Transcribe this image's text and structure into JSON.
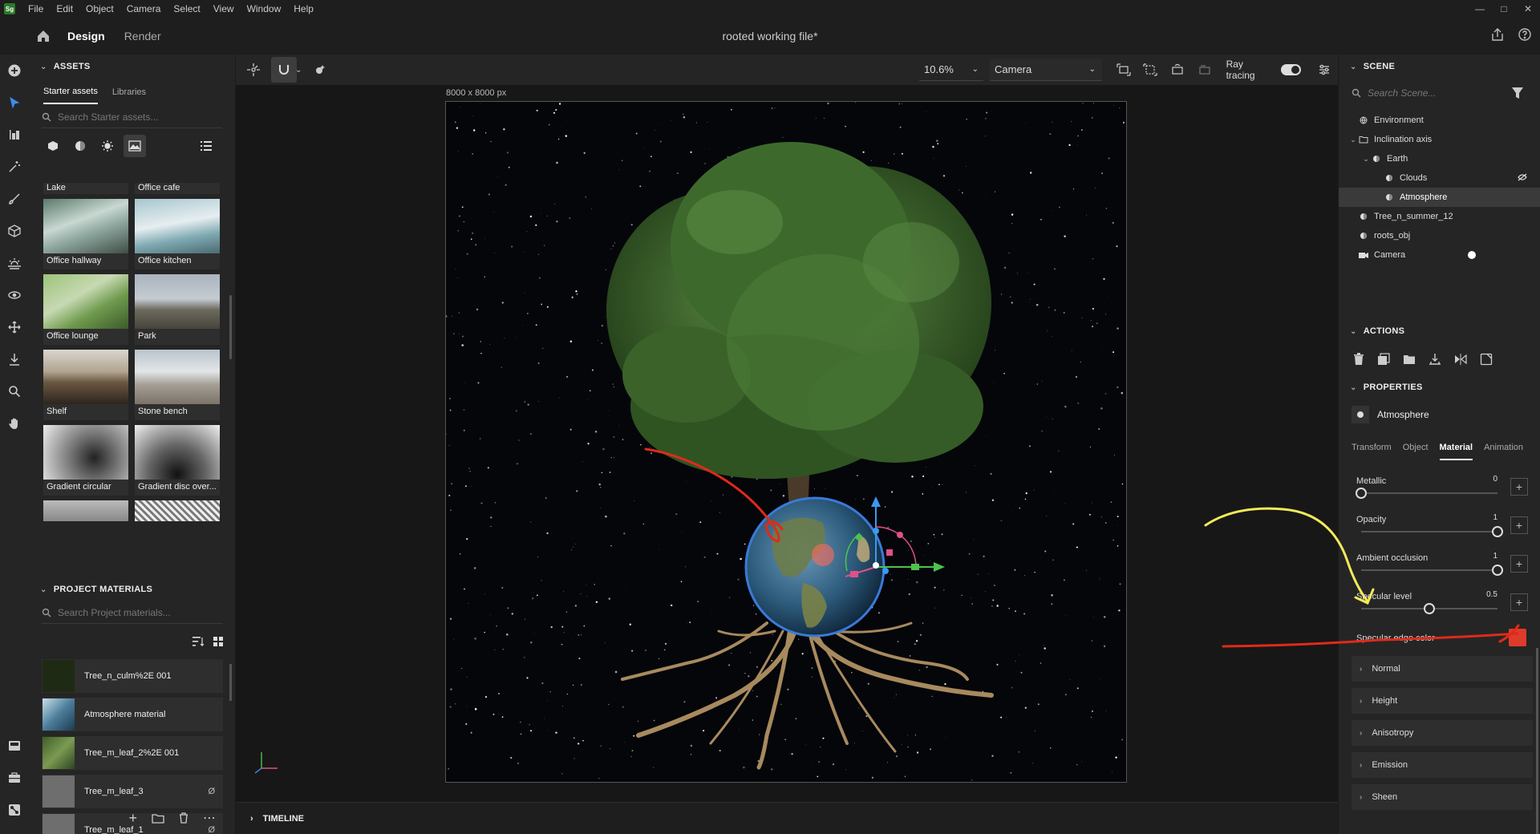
{
  "app": {
    "logo": "Sg",
    "menu": [
      "File",
      "Edit",
      "Object",
      "Camera",
      "Select",
      "View",
      "Window",
      "Help"
    ],
    "window_controls": [
      "minimize",
      "maximize",
      "close"
    ]
  },
  "topbar": {
    "tabs": [
      {
        "label": "Design",
        "active": true
      },
      {
        "label": "Render",
        "active": false
      }
    ],
    "doc_title": "rooted working file*"
  },
  "assets": {
    "header": "ASSETS",
    "tabs": [
      {
        "label": "Starter assets",
        "active": true
      },
      {
        "label": "Libraries",
        "active": false
      }
    ],
    "search_placeholder": "Search Starter assets...",
    "filters": [
      "models-icon",
      "materials-icon",
      "lights-icon",
      "images-icon"
    ],
    "rows": [
      [
        {
          "label": "Lake",
          "partial": true
        },
        {
          "label": "Office cafe",
          "partial": true
        }
      ],
      [
        {
          "label": "Office hallway",
          "thumb": "linear-gradient(160deg,#5a7a6a 0%,#c9d8d2 40%,#8fa8a0 60%,#3e4e46 100%)"
        },
        {
          "label": "Office kitchen",
          "thumb": "linear-gradient(170deg,#a7c6cf 0%,#e6eef0 45%,#7fa9b2 70%,#4b6a72 100%)"
        }
      ],
      [
        {
          "label": "Office lounge",
          "thumb": "linear-gradient(150deg,#9dc37a 0%,#c7d9b2 40%,#6f9a4e 65%,#3c5a2a 100%)"
        },
        {
          "label": "Park",
          "thumb": "linear-gradient(180deg,#aab4bd 0%,#c5ccd2 45%,#6d6a5e 65%,#47443c 100%)"
        }
      ],
      [
        {
          "label": "Shelf",
          "thumb": "linear-gradient(180deg,#d9d6cf 0%,#b2a592 40%,#6b5742 60%,#2d251e 100%)"
        },
        {
          "label": "Stone bench",
          "thumb": "linear-gradient(180deg,#b9c4cc 0%,#e2e6e8 40%,#a39d93 65%,#7c7368 100%)"
        }
      ],
      [
        {
          "label": "Gradient circular",
          "thumb": "radial-gradient(circle at 60% 60%,#222 0%,#777 40%,#eee 100%)"
        },
        {
          "label": "Gradient disc over...",
          "thumb": "radial-gradient(circle at 50% 90%,#111 0%,#666 45%,#f0f0f0 100%)"
        }
      ],
      [
        {
          "label": "",
          "partial_bottom": true,
          "thumb": "linear-gradient(180deg,#bbb,#888)"
        },
        {
          "label": "",
          "partial_bottom": true,
          "thumb": "repeating-linear-gradient(45deg,#eee 0 3px,#777 3px 6px)"
        }
      ]
    ]
  },
  "project_materials": {
    "header": "PROJECT MATERIALS",
    "search_placeholder": "Search Project materials...",
    "items": [
      {
        "label": "Tree_n_culm%2E 001",
        "thumb": "#1f2a14",
        "badge": ""
      },
      {
        "label": "Atmosphere material",
        "thumb": "linear-gradient(135deg,#c9e0ea 0%,#4c7d9a 50%,#1d3b52 100%)",
        "badge": ""
      },
      {
        "label": "Tree_m_leaf_2%2E 001",
        "thumb": "linear-gradient(135deg,#3f5e2a,#7b9a52,#2e4420)",
        "badge": ""
      },
      {
        "label": "Tree_m_leaf_3",
        "thumb": "#6e6e6e",
        "badge": "Ø"
      },
      {
        "label": "Tree_m_leaf_1",
        "thumb": "#6e6e6e",
        "badge": "Ø"
      }
    ]
  },
  "viewport": {
    "zoom": "10.6%",
    "camera": "Camera",
    "ray_tracing_label": "Ray tracing",
    "ray_tracing_on": true,
    "canvas_size": "8000 x 8000 px"
  },
  "timeline": {
    "label": "TIMELINE"
  },
  "scene": {
    "header": "SCENE",
    "search_placeholder": "Search Scene...",
    "tree": [
      {
        "label": "Environment",
        "depth": 0,
        "chevron": "",
        "icon": "environment-icon",
        "selected": false
      },
      {
        "label": "Inclination axis",
        "depth": 0,
        "chevron": "v",
        "icon": "group-icon",
        "selected": false
      },
      {
        "label": "Earth",
        "depth": 1,
        "chevron": "v",
        "icon": "model-icon",
        "selected": false
      },
      {
        "label": "Clouds",
        "depth": 2,
        "chevron": "",
        "icon": "model-icon",
        "selected": false,
        "hidden": true
      },
      {
        "label": "Atmosphere",
        "depth": 2,
        "chevron": "",
        "icon": "model-icon",
        "selected": true
      },
      {
        "label": "Tree_n_summer_12",
        "depth": 0,
        "chevron": "",
        "icon": "model-icon",
        "selected": false
      },
      {
        "label": "roots_obj",
        "depth": 0,
        "chevron": "",
        "icon": "model-icon",
        "selected": false
      },
      {
        "label": "Camera",
        "depth": 0,
        "chevron": "",
        "icon": "camera-icon",
        "selected": false,
        "active_dot": true
      }
    ]
  },
  "actions": {
    "header": "ACTIONS"
  },
  "properties": {
    "header": "PROPERTIES",
    "object": "Atmosphere",
    "tabs": [
      {
        "label": "Transform",
        "active": false
      },
      {
        "label": "Object",
        "active": false
      },
      {
        "label": "Material",
        "active": true
      },
      {
        "label": "Animation",
        "active": false
      }
    ],
    "sliders": [
      {
        "label": "Metallic",
        "value": "0",
        "fraction": 0
      },
      {
        "label": "Opacity",
        "value": "1",
        "fraction": 1
      },
      {
        "label": "Ambient occlusion",
        "value": "1",
        "fraction": 1
      },
      {
        "label": "Specular level",
        "value": "0.5",
        "fraction": 0.5
      }
    ],
    "specular_edge_label": "Specular edge color",
    "specular_edge_color": "#e03a2a",
    "sections": [
      "Normal",
      "Height",
      "Anisotropy",
      "Emission",
      "Sheen"
    ]
  }
}
